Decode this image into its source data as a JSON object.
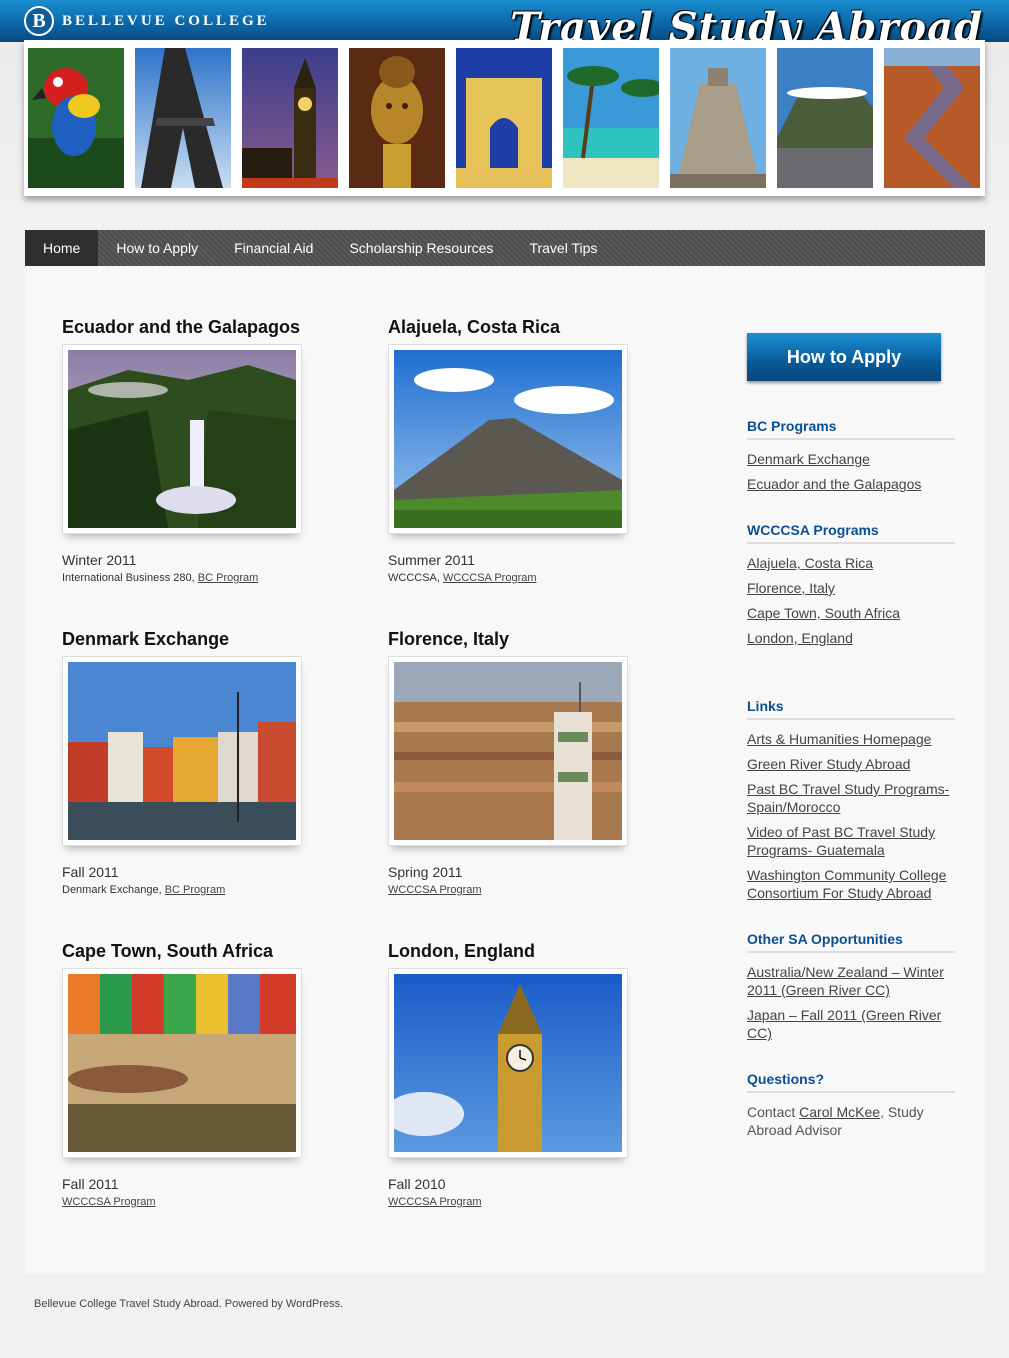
{
  "brand": {
    "logo_letter": "B",
    "name": "BELLEVUE COLLEGE",
    "site_title": "Travel Study Abroad"
  },
  "nav": [
    {
      "label": "Home",
      "active": true
    },
    {
      "label": "How to Apply",
      "active": false
    },
    {
      "label": "Financial Aid",
      "active": false
    },
    {
      "label": "Scholarship Resources",
      "active": false
    },
    {
      "label": "Travel Tips",
      "active": false
    }
  ],
  "programs": [
    {
      "title": "Ecuador and the Galapagos",
      "season": "Winter 2011",
      "desc_prefix": "International Business 280, ",
      "link": "BC Program"
    },
    {
      "title": "Alajuela, Costa Rica",
      "season": "Summer 2011",
      "desc_prefix": "WCCCSA, ",
      "link": "WCCCSA Program"
    },
    {
      "title": "Denmark Exchange",
      "season": "Fall 2011",
      "desc_prefix": "Denmark Exchange, ",
      "link": "BC Program"
    },
    {
      "title": "Florence, Italy",
      "season": "Spring 2011",
      "desc_prefix": "",
      "link": "WCCCSA Program"
    },
    {
      "title": "Cape Town, South Africa",
      "season": "Fall 2011",
      "desc_prefix": "",
      "link": "WCCCSA Program"
    },
    {
      "title": "London, England",
      "season": "Fall 2010",
      "desc_prefix": "",
      "link": "WCCCSA Program"
    }
  ],
  "sidebar": {
    "apply_button": "How to Apply",
    "bc_programs": {
      "heading": "BC Programs",
      "links": [
        "Denmark Exchange",
        "Ecuador and the Galapagos"
      ]
    },
    "wcccsa_programs": {
      "heading": "WCCCSA Programs",
      "links": [
        "Alajuela, Costa Rica",
        "Florence, Italy",
        "Cape Town, South Africa",
        "London, England"
      ]
    },
    "links": {
      "heading": "Links",
      "links": [
        "Arts & Humanities Homepage",
        "Green River Study Abroad",
        "Past BC Travel Study Programs-Spain/Morocco",
        "Video of Past BC Travel Study Programs- Guatemala",
        "Washington Community College Consortium For Study Abroad"
      ]
    },
    "other": {
      "heading": "Other SA Opportunities",
      "links": [
        "Australia/New Zealand – Winter 2011 (Green River CC)",
        "Japan – Fall 2011 (Green River CC)"
      ]
    },
    "questions": {
      "heading": "Questions?",
      "prefix": "Contact ",
      "link": "Carol McKee",
      "suffix": ", Study Abroad Advisor"
    }
  },
  "footer": "Bellevue College Travel Study Abroad. Powered by WordPress.",
  "colors": {
    "brand_blue": "#0a5e9c",
    "heading_blue": "#0b4f93",
    "nav_bg": "#555555",
    "nav_active": "#2f2f2f"
  }
}
